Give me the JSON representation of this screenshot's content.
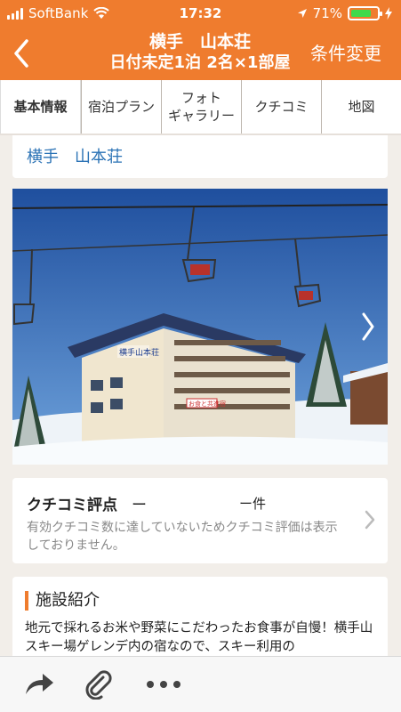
{
  "status_bar": {
    "carrier": "SoftBank",
    "time": "17:32",
    "battery": "71%",
    "battery_level": 0.71
  },
  "header": {
    "title": "横手　山本荘",
    "subtitle": "日付未定1泊 2名×1部屋",
    "condition_button": "条件変更",
    "colors": {
      "accent": "#ef7c2e"
    }
  },
  "tabs": [
    {
      "label": "基本情報",
      "active": true
    },
    {
      "label": "宿泊プラン",
      "active": false
    },
    {
      "label": "フォト\nギャラリー",
      "active": false
    },
    {
      "label": "クチコミ",
      "active": false
    },
    {
      "label": "地図",
      "active": false
    }
  ],
  "hotel_name": "横手　山本荘",
  "photo": {
    "sign_text": "横手山本荘",
    "banner_text": "お食と共進宿"
  },
  "reviews": {
    "title": "クチコミ評点",
    "score": "ー",
    "count": "ー件",
    "note": "有効クチコミ数に達していないためクチコミ評価は表示しておりません。"
  },
  "facility": {
    "title": "施設紹介",
    "text": "地元で採れるお米や野菜にこだわったお食事が自慢！横手山スキー場ゲレンデ内の宿なので、スキー利用の"
  },
  "toolbar": {
    "icons": [
      "share-icon",
      "paperclip-icon",
      "more-icon"
    ]
  }
}
